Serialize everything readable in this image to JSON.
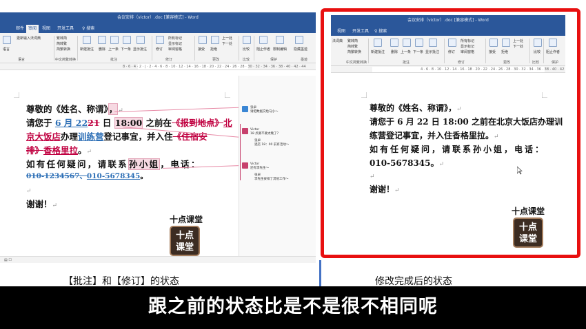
{
  "left_window": {
    "title": "会议安排（victor）.doc [兼容模式] - Word",
    "tabs": [
      "邮件",
      "审阅",
      "视图",
      "开发工具"
    ],
    "tell_me": "♀ 搜索",
    "ribbon": {
      "language_btn": "语言",
      "trans": [
        "繁转简",
        "简转繁",
        "简繁转换"
      ],
      "input_dict": "更新输入法词典",
      "new_comment": "新建批注",
      "delete": "删除",
      "prev": "上一条",
      "next": "下一条",
      "show_comments": "显示批注",
      "track": "修订",
      "all_markup": "所有标记",
      "show_markup": "显示标记",
      "review_pane": "审阅窗格",
      "accept": "接受",
      "reject": "拒绝",
      "prev_change": "上一处",
      "next_change": "下一处",
      "compare": "比较",
      "block_authors": "阻止作者",
      "restrict": "限制编辑",
      "hide_ink": "隐藏墨迹",
      "groups": {
        "lang": "语言",
        "chinese": "中文简繁转换",
        "comments": "批注",
        "tracking": "修订",
        "changes": "更改",
        "compare": "比较",
        "protect": "保护",
        "ink": "墨迹"
      }
    },
    "ruler": "8 · 6 · 4 · 2 · | · 2 · 4 · 6 · 8 · 10 · 12 · 14 · 16 · 18 · 20 · 22 · 24 · 26 · 28 · 30 · 32 · 34 · 36 · 38 · 40 · 42 · 44",
    "doc": {
      "l1_a": "尊敬的《姓名、称谓》",
      "l1_b": "，",
      "l2_a": "请您于 ",
      "l2_ins1": "6 月 22",
      "l2_del1": "21",
      "l2_b": " 日 ",
      "l2_time": "18:00",
      "l2_c": " 之前在",
      "l2_del2": "《报到地点》",
      "l2_ins2": "北",
      "l3_ins2": "京大饭店",
      "l3_a": "办理",
      "l3_ins3": "训练营",
      "l3_b": "登记事宜，并入住",
      "l3_del3": "《住宿安",
      "l4_del3": "排》",
      "l4_ins4": "香格里拉",
      "l4_a": "。",
      "l5_a": "如有任何疑问，请联系",
      "l5_name": "孙小姐",
      "l5_b": "，电话：",
      "l6_del": "010-1234567、",
      "l6_ins": "010-5678345",
      "l6_end": "。",
      "l8": "谢谢！",
      "para": "↵"
    },
    "comments": [
      {
        "author": "张卓",
        "text": "请把数据交给马小～"
      },
      {
        "author": "Victor",
        "text": "18 点要不要太晚了？"
      },
      {
        "author": "张卓",
        "text": "酒店 18：00 前有活动～"
      },
      {
        "author": "Victor",
        "text": "还有李先生～"
      },
      {
        "author": "张卓",
        "text": "李先生安排了其他工作～"
      }
    ],
    "logo_caption": "十点课堂",
    "logo_lines": [
      "十点",
      "课堂"
    ],
    "status": "▤  ☐"
  },
  "right_window": {
    "title": "会议安排（victor）.doc [兼容模式] - Word",
    "tabs": [
      "视图",
      "开发工具"
    ],
    "tell_me": "♀ 搜索",
    "ribbon": {
      "dict": "法词典",
      "trans": [
        "繁转简",
        "简转繁",
        "简繁转换"
      ],
      "new_comment": "新建批注",
      "delete": "删除",
      "prev": "上一条",
      "next": "下一条",
      "show_comments": "显示批注",
      "track": "修订",
      "all_markup": "所有标记",
      "show_markup": "显示标记",
      "review_pane": "审阅窗格",
      "accept": "接受",
      "reject": "拒绝",
      "prev_change": "上一处",
      "next_change": "下一处",
      "compare": "比较",
      "block_authors": "阻止作者",
      "restrict": "限制编辑",
      "groups": {
        "chinese": "中文简繁转换",
        "comments": "批注",
        "tracking": "修订",
        "changes": "更改",
        "compare": "比较",
        "protect": "保护"
      }
    },
    "ruler": "4 · 6 · 8 · 10 · 12 · 14 · 16 · 18 · 20 · 22 · 24 · 26 · 28 · 30 · 32 · 34 · 36 · 38 · 40 · 42 · 44 · 46",
    "doc": {
      "l1": "尊敬的《姓名、称谓》，",
      "l2": "请您于 6 月 22 日 18:00 之前在北京大饭店办理训",
      "l3": "练营登记事宜，并入住香格里拉。",
      "l4": "如有任何疑问，请联系孙小姐，电话：",
      "l5": "010-5678345。",
      "l7": "谢谢！",
      "para": "↵"
    },
    "logo_caption": "十点课堂",
    "logo_lines": [
      "十点",
      "课堂"
    ]
  },
  "captions": {
    "left": "【批注】和【修订】的状态",
    "right": "修改完成后的状态"
  },
  "subtitle": "跟之前的状态比是不是很不相同呢",
  "colors": {
    "word_blue": "#2b579a",
    "red_frame": "#e81010",
    "revision": "#c00040",
    "divider": "#4472c4"
  }
}
